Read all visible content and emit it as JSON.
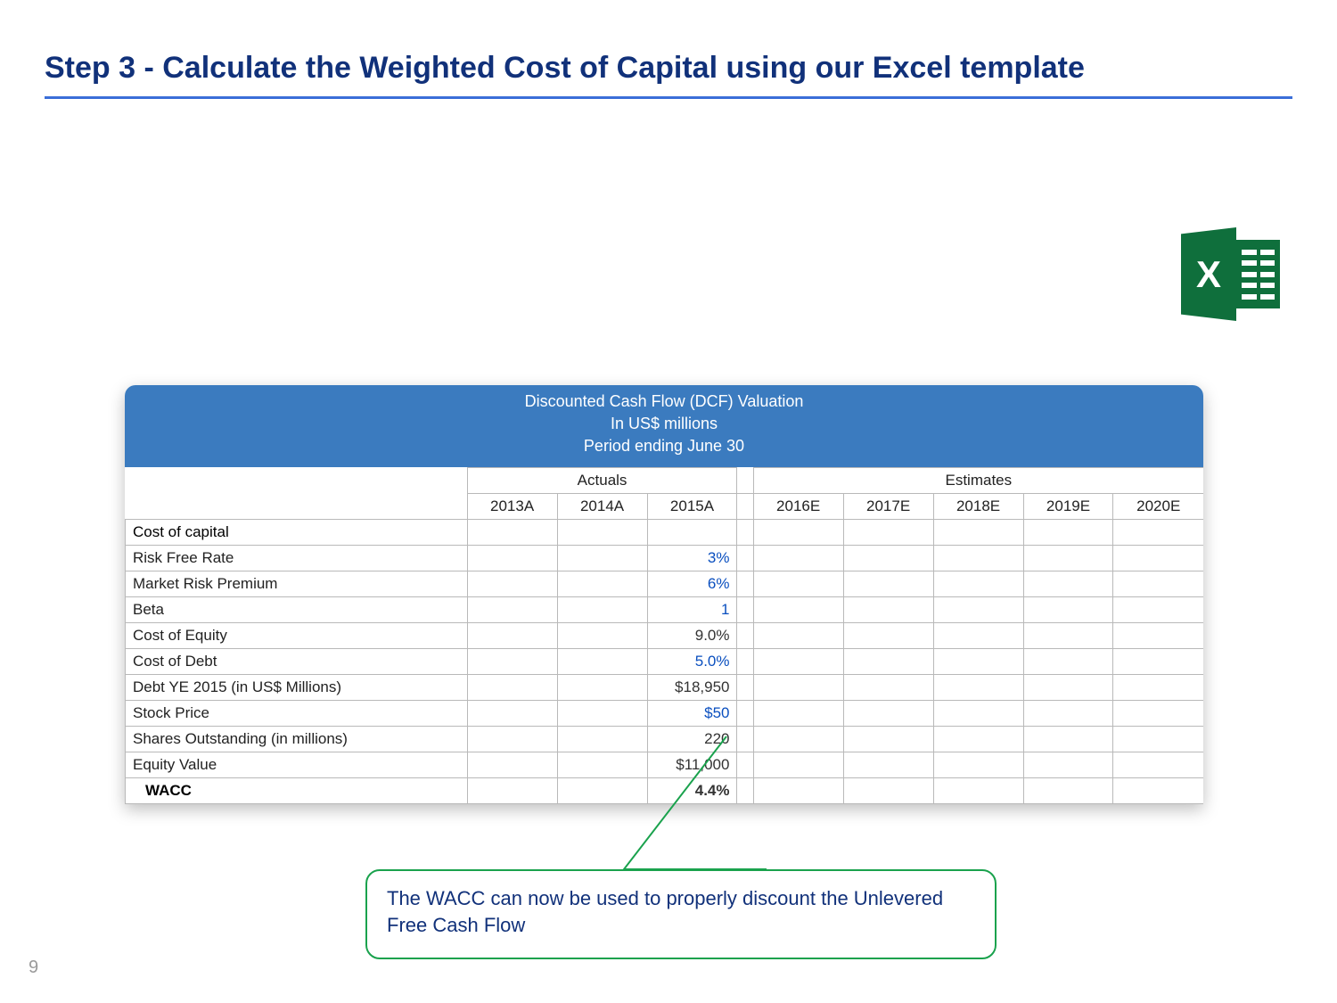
{
  "title": "Step 3 - Calculate the Weighted Cost of Capital using our Excel template",
  "page_number": "9",
  "excel_icon_letter": "X",
  "table": {
    "header_line1": "Discounted Cash Flow (DCF) Valuation",
    "header_line2": "In US$ millions",
    "header_line3": "Period ending June 30",
    "group_actuals": "Actuals",
    "group_estimates": "Estimates",
    "years": [
      "2013A",
      "2014A",
      "2015A",
      "2016E",
      "2017E",
      "2018E",
      "2019E",
      "2020E"
    ],
    "section_label": "Cost of capital",
    "rows": {
      "risk_free": {
        "label": "Risk Free Rate",
        "v": "3%",
        "blue": true
      },
      "mrp": {
        "label": "Market Risk Premium",
        "v": "6%",
        "blue": true
      },
      "beta": {
        "label": "Beta",
        "v": "1",
        "blue": true
      },
      "coe": {
        "label": "Cost of Equity",
        "v": "9.0%",
        "blue": false
      },
      "cod": {
        "label": "Cost of Debt",
        "v": "5.0%",
        "blue": true
      },
      "debt": {
        "label": "Debt YE 2015 (in US$ Millions)",
        "v": "$18,950",
        "blue": false
      },
      "price": {
        "label": "Stock Price",
        "v": "$50",
        "blue": true
      },
      "shares": {
        "label": "Shares Outstanding (in millions)",
        "v": "220",
        "blue": false
      },
      "ev": {
        "label": "Equity Value",
        "v": "$11,000",
        "blue": false
      }
    },
    "wacc_label": "WACC",
    "wacc_value": "4.4%"
  },
  "callout_text": "The WACC can now be used to properly discount the Unlevered Free Cash Flow",
  "chart_data": {
    "type": "table",
    "title": "Discounted Cash Flow (DCF) Valuation — Cost of capital inputs (2015A column)",
    "columns": [
      "Metric",
      "2015A"
    ],
    "rows": [
      [
        "Risk Free Rate",
        "3%"
      ],
      [
        "Market Risk Premium",
        "6%"
      ],
      [
        "Beta",
        "1"
      ],
      [
        "Cost of Equity",
        "9.0%"
      ],
      [
        "Cost of Debt",
        "5.0%"
      ],
      [
        "Debt YE 2015 (in US$ Millions)",
        "$18,950"
      ],
      [
        "Stock Price",
        "$50"
      ],
      [
        "Shares Outstanding (in millions)",
        "220"
      ],
      [
        "Equity Value",
        "$11,000"
      ],
      [
        "WACC",
        "4.4%"
      ]
    ]
  }
}
